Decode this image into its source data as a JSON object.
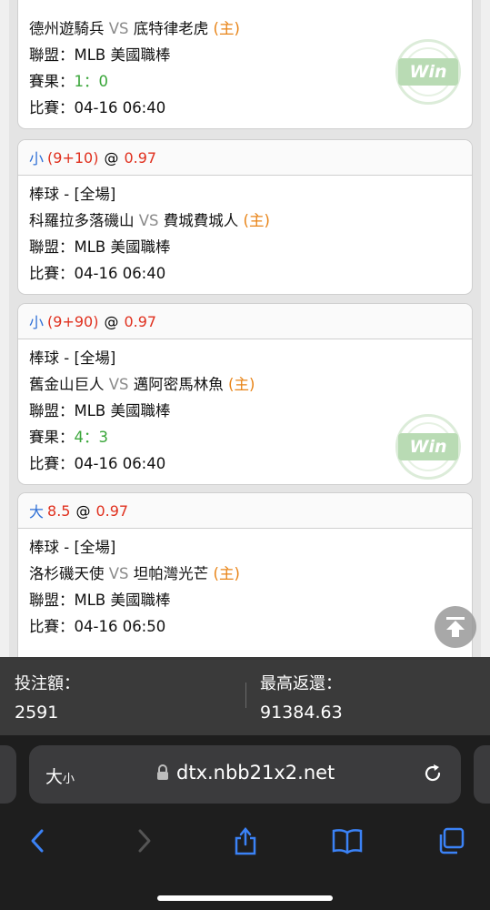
{
  "colors": {
    "accent_blue": "#2e6fd6",
    "odds_red": "#e0301e",
    "home_orange": "#e88418",
    "score_green": "#3aa63a"
  },
  "labels": {
    "league": "聯盟：",
    "result": "賽果：",
    "match_time": "比賽：",
    "vs": "VS",
    "home_tag": "(主)",
    "at": "@",
    "win": "Win"
  },
  "bets": [
    {
      "away": "德州遊騎兵",
      "home": "底特律老虎",
      "league": "MLB 美國職棒",
      "result": "1：0",
      "time": "04-16 06:40",
      "won": true
    },
    {
      "pick": "小",
      "line": "(9+10)",
      "odds": "0.97",
      "sport": "棒球 - [全場]",
      "away": "科羅拉多落磯山",
      "home": "費城費城人",
      "league": "MLB 美國職棒",
      "time": "04-16 06:40",
      "won": false
    },
    {
      "pick": "小",
      "line": "(9+90)",
      "odds": "0.97",
      "sport": "棒球 - [全場]",
      "away": "舊金山巨人",
      "home": "邁阿密馬林魚",
      "league": "MLB 美國職棒",
      "result": "4：3",
      "time": "04-16 06:40",
      "won": true
    },
    {
      "pick": "大",
      "line": "8.5",
      "odds": "0.97",
      "sport": "棒球 - [全場]",
      "away": "洛杉磯天使",
      "home": "坦帕灣光芒",
      "league": "MLB 美國職棒",
      "time": "04-16 06:50",
      "won": false
    }
  ],
  "summary": {
    "stake_label": "投注額：",
    "stake_value": "2591",
    "max_return_label": "最高返還：",
    "max_return_value": "91384.63"
  },
  "browser": {
    "text_size_big": "大",
    "text_size_small": "小",
    "url": "dtx.nbb21x2.net",
    "icons": [
      "lock-icon",
      "reload-icon",
      "back-icon",
      "forward-icon",
      "share-icon",
      "bookmarks-icon",
      "tabs-icon",
      "scroll-top-icon"
    ]
  }
}
